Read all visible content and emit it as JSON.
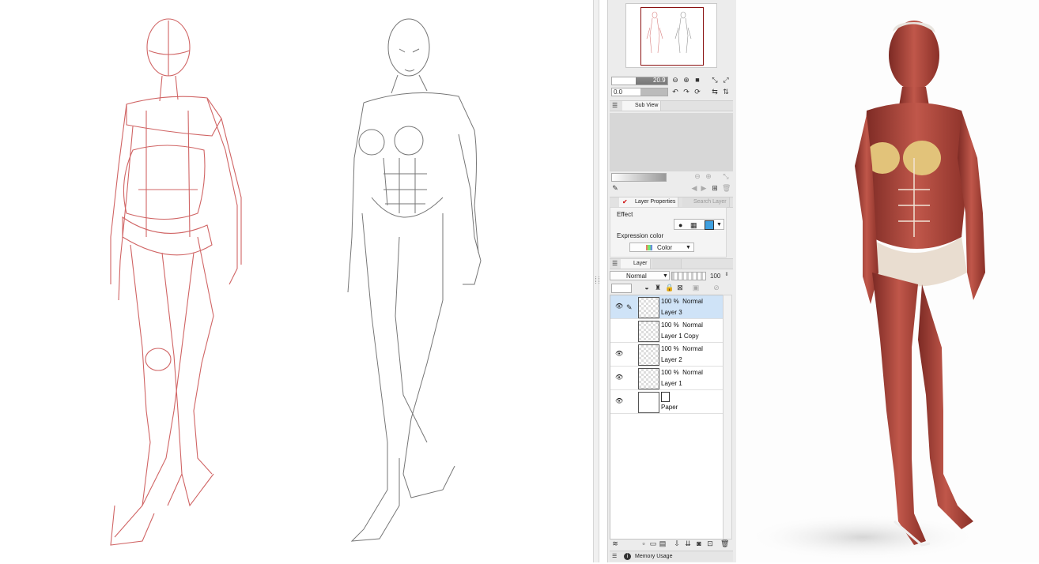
{
  "navigator": {
    "zoom_value": "20.9",
    "rotate_value": "0.0",
    "subview_tab": "Sub View"
  },
  "layer_properties": {
    "tab_label": "Layer Properties",
    "search_tab_label": "Search Layer",
    "effect_label": "Effect",
    "expression_color_label": "Expression color",
    "expression_color_value": "Color"
  },
  "layer_panel": {
    "tab_label": "Layer",
    "blend_mode": "Normal",
    "opacity": "100",
    "layers": [
      {
        "percent": "100 %",
        "mode": "Normal",
        "name": "Layer 3",
        "visible": true,
        "selected": true
      },
      {
        "percent": "100 %",
        "mode": "Normal",
        "name": "Layer 1 Copy",
        "visible": false,
        "selected": false
      },
      {
        "percent": "100 %",
        "mode": "Normal",
        "name": "Layer 2",
        "visible": true,
        "selected": false
      },
      {
        "percent": "100 %",
        "mode": "Normal",
        "name": "Layer 1",
        "visible": true,
        "selected": false
      },
      {
        "percent": "",
        "mode": "",
        "name": "Paper",
        "visible": true,
        "selected": false
      }
    ]
  },
  "status": {
    "memory_usage_label": "Memory Usage"
  },
  "colors": {
    "selection": "#cfe3f7",
    "sketch_red": "#c84a4a",
    "muscle": "#b0433a",
    "navigator_frame": "#8a1010"
  }
}
